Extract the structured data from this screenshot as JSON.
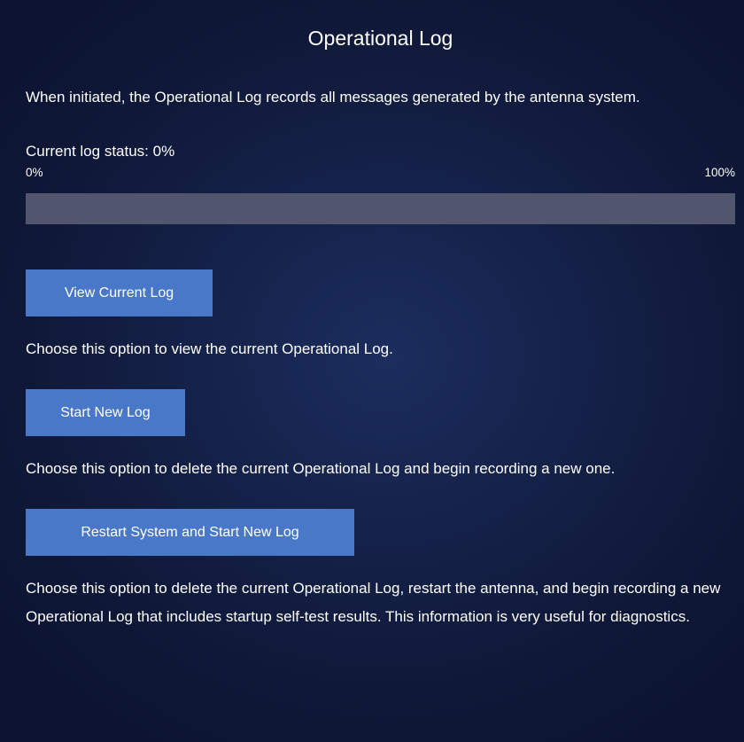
{
  "page": {
    "title": "Operational Log",
    "intro": "When initiated, the Operational Log records all messages generated by the antenna system."
  },
  "status": {
    "label": "Current log status: 0%",
    "progress_fraction": 0,
    "scale_min": "0%",
    "scale_max": "100%"
  },
  "actions": {
    "view": {
      "label": "View Current Log",
      "description": "Choose this option to view the current Operational Log."
    },
    "start": {
      "label": "Start New Log",
      "description": "Choose this option to delete the current Operational Log and begin recording a new one."
    },
    "restart": {
      "label": "Restart System and Start New Log",
      "description": "Choose this option to delete the current Operational Log, restart the antenna, and begin recording a new Operational Log that includes startup self-test results. This information is very useful for diagnostics."
    }
  },
  "colors": {
    "background": "#0d1530",
    "button": "#4a78c8",
    "progress_track": "#51556e"
  }
}
